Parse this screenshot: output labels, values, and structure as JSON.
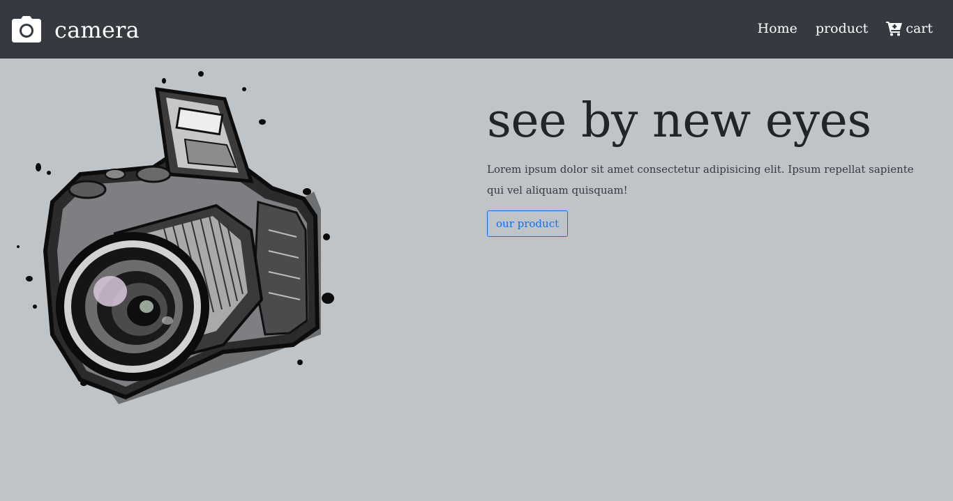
{
  "navbar": {
    "brand_icon": "camera-icon",
    "brand_name": "camera",
    "links": [
      {
        "label": "Home"
      },
      {
        "label": "product"
      },
      {
        "label": "cart",
        "icon": "cart-icon"
      }
    ]
  },
  "hero": {
    "image": "camera-illustration",
    "title": "see by new eyes",
    "description": "Lorem ipsum dolor sit amet consectetur adipisicing elit. Ipsum repellat sapiente qui vel aliquam quisquam!",
    "button_label": "our product"
  },
  "colors": {
    "navbar_bg": "#343a40",
    "page_bg": "#bfc4c8",
    "accent": "#0d6efd",
    "title_text": "#212529"
  }
}
